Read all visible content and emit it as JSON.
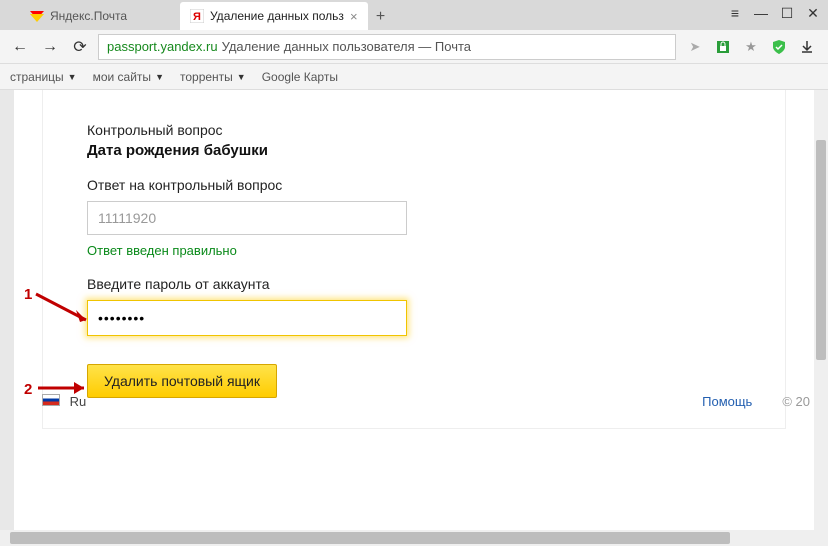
{
  "tabs": {
    "inactive_label": "Яндекс.Почта",
    "active_label": "Удаление данных польз"
  },
  "address": {
    "host": "passport.yandex.ru",
    "title": "Удаление данных пользователя — Почта"
  },
  "bookmarks": {
    "pages": "страницы",
    "my_sites": "мои сайты",
    "torrents": "торренты",
    "google_maps": "Google Карты"
  },
  "content": {
    "security_question_title": "Контрольный вопрос",
    "security_question_text": "Дата рождения бабушки",
    "answer_label": "Ответ на контрольный вопрос",
    "answer_value": "11111920",
    "status_ok": "Ответ введен правильно",
    "password_label": "Введите пароль от аккаунта",
    "password_value": "••••••••",
    "delete_button": "Удалить почтовый ящик"
  },
  "annotations": {
    "one": "1",
    "two": "2"
  },
  "footer": {
    "lang": "Ru",
    "help": "Помощь",
    "copy": "© 20"
  }
}
